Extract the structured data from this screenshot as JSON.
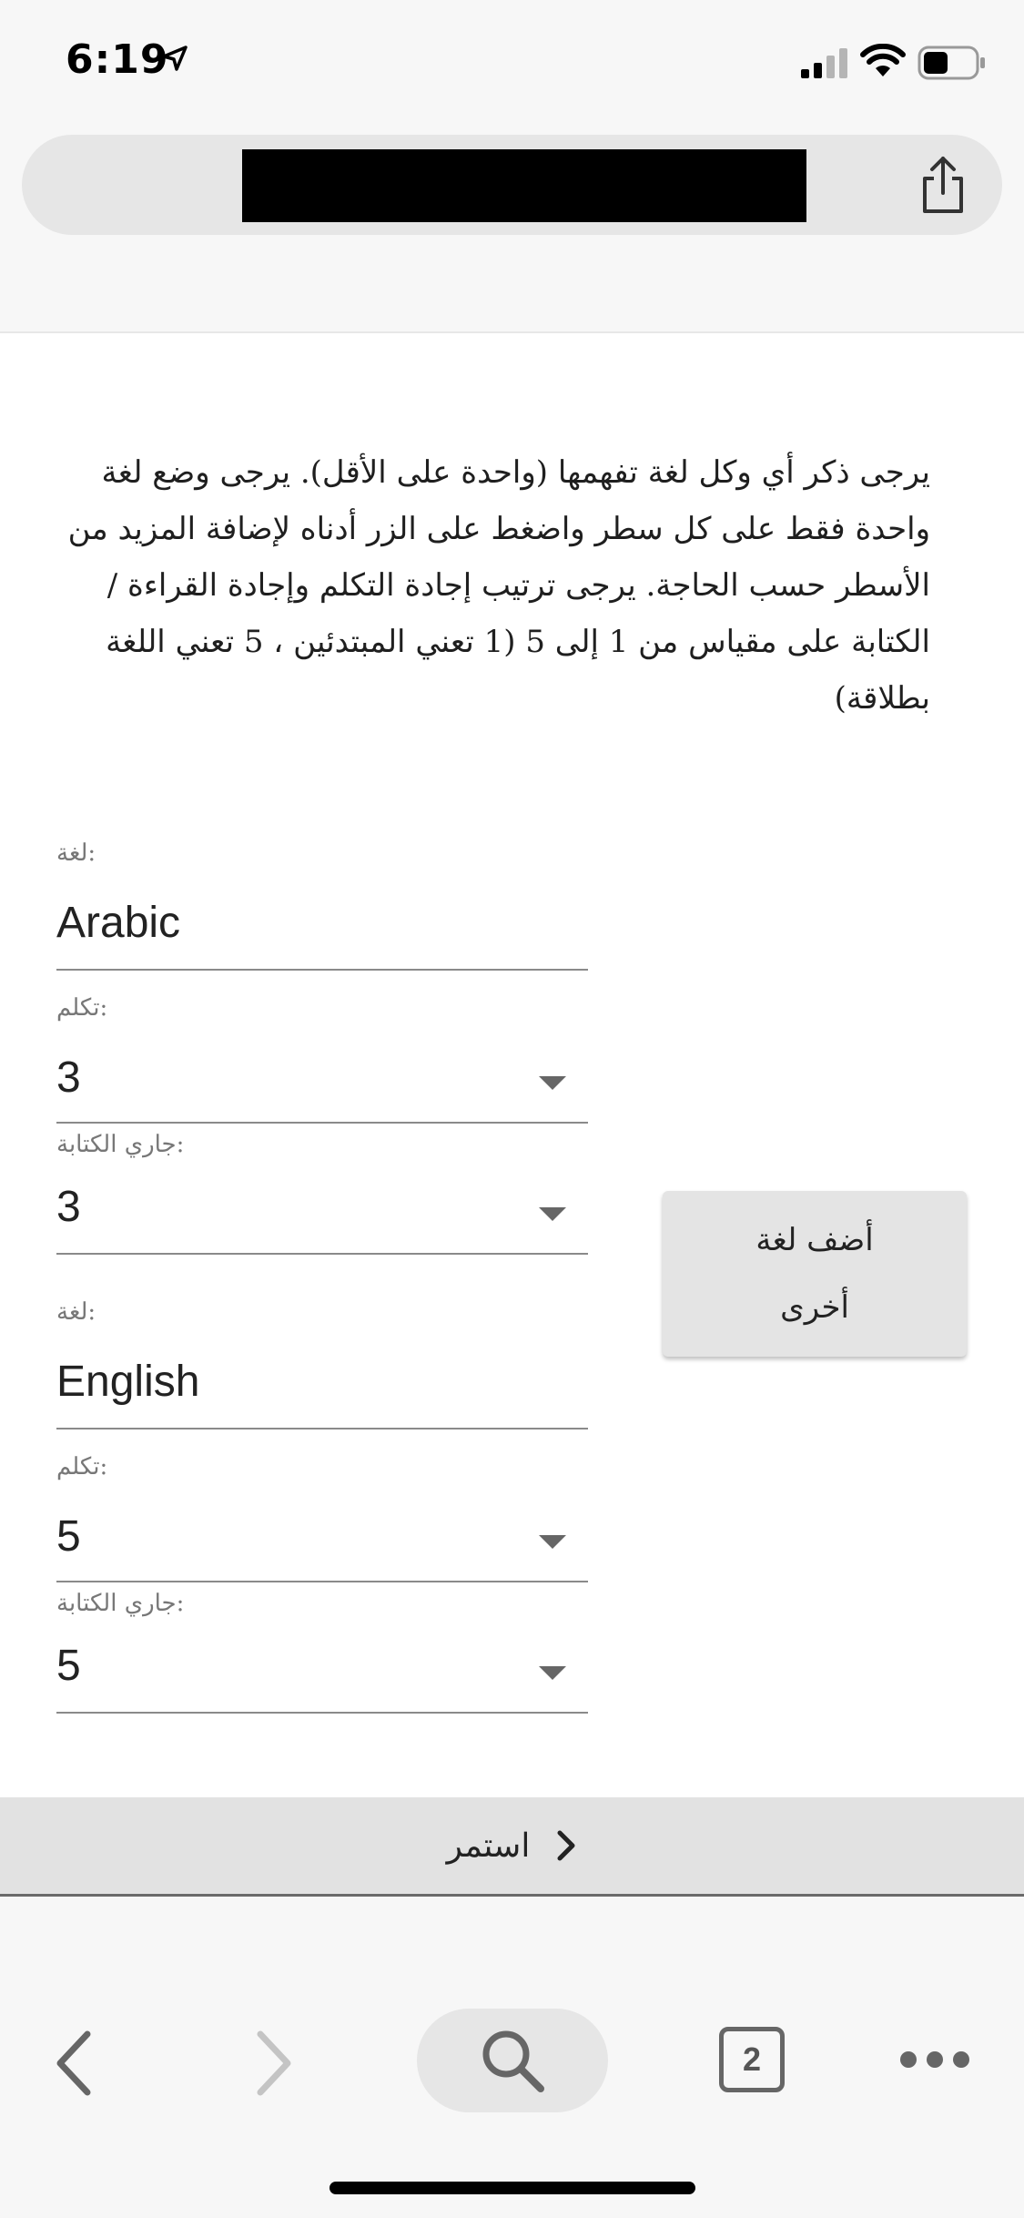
{
  "status_bar": {
    "time": "6:19",
    "icons": [
      "location-arrow-icon",
      "cellular-signal-icon",
      "wifi-icon",
      "battery-icon"
    ]
  },
  "browser": {
    "share_icon": "share-icon"
  },
  "form": {
    "instructions": "يرجى ذكر أي وكل لغة تفهمها (واحدة على الأقل). يرجى وضع لغة واحدة فقط على كل سطر واضغط على الزر أدناه لإضافة المزيد من الأسطر حسب الحاجة. يرجى ترتيب إجادة التكلم وإجادة القراءة / الكتابة على مقياس من 1 إلى 5 (1 تعني المبتدئين ، 5 تعني اللغة بطلاقة)",
    "entries": [
      {
        "language_label": "لغة:",
        "language_value": "Arabic",
        "speaking_label": "تكلم:",
        "speaking_value": "3",
        "writing_label": "جاري الكتابة:",
        "writing_value": "3"
      },
      {
        "language_label": "لغة:",
        "language_value": "English",
        "speaking_label": "تكلم:",
        "speaking_value": "5",
        "writing_label": "جاري الكتابة:",
        "writing_value": "5"
      }
    ],
    "add_language_button": "أضف لغة أخرى",
    "continue_button": "استمر"
  },
  "toolbar": {
    "tabs_count": "2",
    "icons": [
      "back-icon",
      "forward-icon",
      "search-icon",
      "tabs-icon",
      "more-icon"
    ]
  },
  "colors": {
    "accent_gray": "#e2e2e2",
    "text": "#1f1f1f"
  }
}
